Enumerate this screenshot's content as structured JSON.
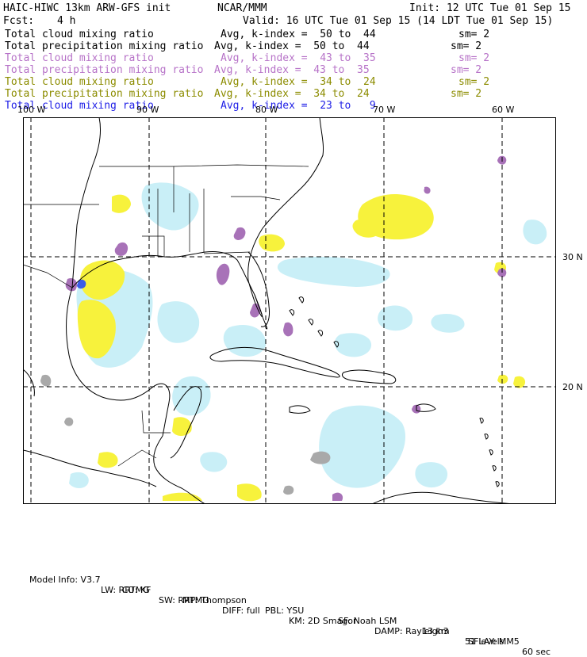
{
  "header": {
    "title": "HAIC-HIWC 13km ARW-GFS init",
    "org": "NCAR/MMM",
    "init": "Init: 12 UTC Tue 01 Sep 15",
    "fcst_label": "Fcst:",
    "fcst_value": "4 h",
    "valid": "Valid: 16 UTC Tue 01 Sep 15 (14 LDT Tue 01 Sep 15)"
  },
  "legend": [
    {
      "name": "Total cloud mixing ratio",
      "range": "Avg, k-index =  50 to  44",
      "sm": "sm= 2",
      "color": "#000000"
    },
    {
      "name": "Total precipitation mixing ratio",
      "range": "Avg, k-index =  50 to  44",
      "sm": "sm= 2",
      "color": "#000000"
    },
    {
      "name": "Total cloud mixing ratio",
      "range": "Avg, k-index =  43 to  35",
      "sm": "sm= 2",
      "color": "#b773c8"
    },
    {
      "name": "Total precipitation mixing ratio",
      "range": "Avg, k-index =  43 to  35",
      "sm": "sm= 2",
      "color": "#b773c8"
    },
    {
      "name": "Total cloud mixing ratio",
      "range": "Avg, k-index =  34 to  24",
      "sm": "sm= 2",
      "color": "#8c8c00"
    },
    {
      "name": "Total precipitation mixing ratio",
      "range": "Avg, k-index =  34 to  24",
      "sm": "sm= 2",
      "color": "#8c8c00"
    },
    {
      "name": "Total cloud mixing ratio",
      "range": "Avg, k-index =  23 to   9",
      "sm": "",
      "color": "#1e1ee6"
    }
  ],
  "map": {
    "lon_labels": [
      "100 W",
      "90 W",
      "80 W",
      "70 W",
      "60 W"
    ],
    "lat_labels": [
      "30 N",
      "20 N"
    ],
    "colors": {
      "cloud_light": "#c9eff7",
      "yellow": "#f7f23c",
      "purple": "#a872b8",
      "gray": "#a9a9a9",
      "blue": "#3a5ce6"
    }
  },
  "footer": {
    "line1": [
      "Model Info: V3.7",
      "CU: KF",
      "MP: Thompson",
      "PBL: YSU",
      "SF: Noah LSM",
      "13 km",
      "51 levels",
      "60 sec"
    ],
    "line2": [
      "LW: RRTMG",
      "SW: RRTMG",
      "DIFF: full",
      "KM: 2D Smagor",
      "DAMP: Rayleigh3",
      "SFLAY: MM5"
    ]
  }
}
